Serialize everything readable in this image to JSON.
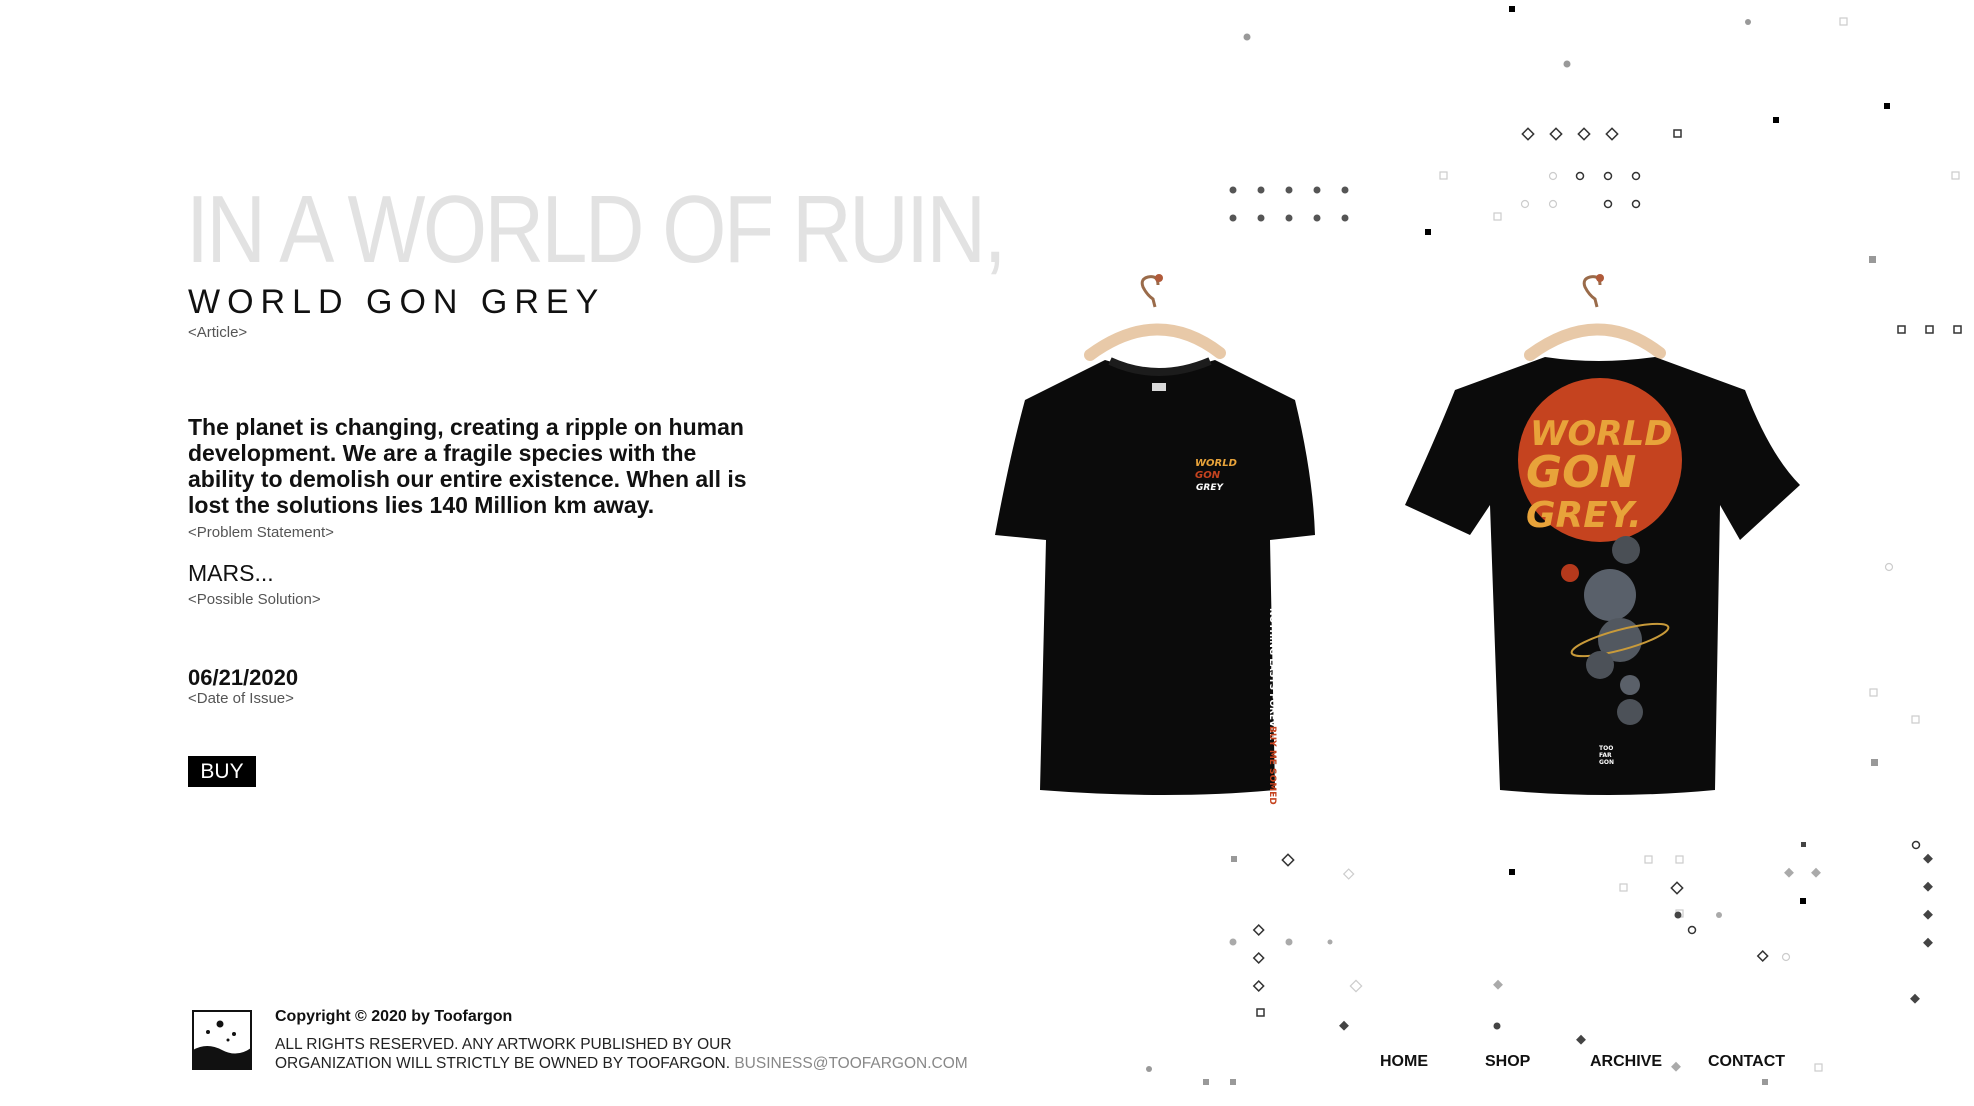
{
  "hero": {
    "title": "IN A WORLD OF RUIN,",
    "subtitle": "WORLD GON GREY",
    "subtitle_tag": "<Article>"
  },
  "content": {
    "statement": "The planet is changing, creating a ripple on human development. We are a fragile species with the ability to demolish our entire existence. When all is lost the solutions lies 140 Million km away.",
    "statement_tag": "<Problem Statement>",
    "solution": "MARS...",
    "solution_tag": "<Possible Solution>",
    "date": "06/21/2020",
    "date_tag": "<Date of Issue>",
    "buy_label": "BUY"
  },
  "product": {
    "front_print": [
      "WORLD",
      "GON",
      "GREY"
    ],
    "sleeve_print": "NOTHING LASTS FOREVER",
    "sleeve_print_accent": "BUY ME SOMEDAY",
    "back_print": [
      "WORLD",
      "GON",
      "GREY."
    ],
    "back_label": [
      "TOO",
      "FAR",
      "GON"
    ]
  },
  "footer": {
    "copyright": "Copyright © 2020 by Toofargon",
    "rights_line1": "ALL RIGHTS RESERVED. ANY ARTWORK PUBLISHED BY OUR",
    "rights_line2": "ORGANIZATION WILL STRICTLY BE OWNED BY TOOFARGON.",
    "email": "BUSINESS@TOOFARGON.COM"
  },
  "nav": {
    "home": "HOME",
    "shop": "SHOP",
    "archive": "ARCHIVE",
    "contact": "CONTACT"
  },
  "colors": {
    "accent_mars": "#c5431f",
    "accent_print": "#e8a33a",
    "shirt": "#0b0b0b",
    "title_grey": "#e2e2e2"
  }
}
